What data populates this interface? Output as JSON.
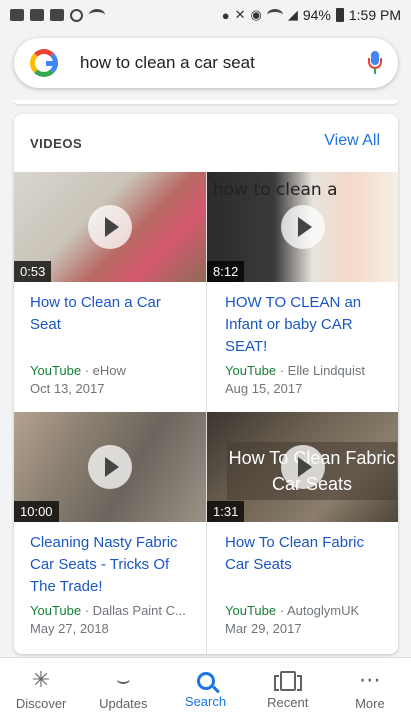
{
  "status_bar": {
    "battery": "94%",
    "time": "1:59 PM"
  },
  "search": {
    "query": "how to clean a car seat"
  },
  "videos_card": {
    "title": "VIDEOS",
    "view_all": "View All",
    "items": [
      {
        "title": "How to Clean a Car Seat",
        "duration": "0:53",
        "source": "YouTube",
        "channel": "eHow",
        "date": "Oct 13, 2017",
        "thumb_text": ""
      },
      {
        "title": "HOW TO CLEAN an Infant or baby CAR SEAT!",
        "duration": "8:12",
        "source": "YouTube",
        "channel": "Elle Lindquist",
        "date": "Aug 15, 2017",
        "thumb_text": "how to clean a"
      },
      {
        "title": "Cleaning Nasty Fabric Car Seats - Tricks Of The Trade!",
        "duration": "10:00",
        "source": "YouTube",
        "channel": "Dallas Paint C...",
        "date": "May 27, 2018",
        "thumb_text": ""
      },
      {
        "title": "How To Clean Fabric Car Seats",
        "duration": "1:31",
        "source": "YouTube",
        "channel": "AutoglymUK",
        "date": "Mar 29, 2017",
        "thumb_text": "How To Clean Fabric Car Seats"
      }
    ]
  },
  "bottom_nav": {
    "items": [
      {
        "label": "Discover",
        "icon": "asterisk-icon"
      },
      {
        "label": "Updates",
        "icon": "updates-icon"
      },
      {
        "label": "Search",
        "icon": "search-icon",
        "active": true
      },
      {
        "label": "Recent",
        "icon": "recent-icon"
      },
      {
        "label": "More",
        "icon": "more-icon"
      }
    ]
  },
  "colors": {
    "link": "#1a56c4",
    "source": "#188038",
    "accent": "#1a73e8"
  }
}
